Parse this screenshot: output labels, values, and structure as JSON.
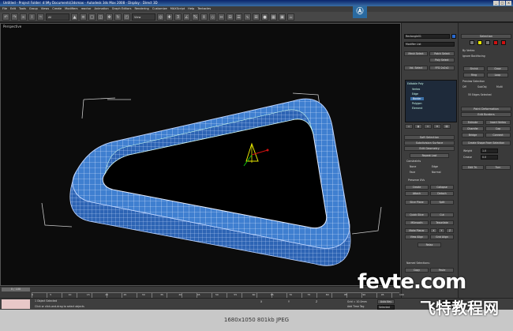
{
  "window": {
    "title": "Untitled  -  Project Folder: d:\\My Documents\\3dsmax  -  Autodesk 3ds Max 2008  -  Display : Direct 3D",
    "controls": [
      "_",
      "□",
      "×"
    ]
  },
  "menu": [
    "File",
    "Edit",
    "Tools",
    "Group",
    "Views",
    "Create",
    "Modifiers",
    "reactor",
    "Animation",
    "Graph Editors",
    "Rendering",
    "Customize",
    "MAXScript",
    "Help",
    "Tentacles"
  ],
  "toolbar": {
    "selection_filter": "All",
    "view_dropdown": "View"
  },
  "logo": "Ⓐ",
  "viewport": {
    "label": "Perspective"
  },
  "command_panel": {
    "object_name": "Rectangle01",
    "modifier_list": "Modifier List",
    "buttons": [
      "Mesh Select",
      "Patch Select",
      "Poly Select",
      "Vol. Select",
      "FFD 2x2x2"
    ],
    "stack": [
      "Editable Poly",
      "Vertex",
      "Edge",
      "Border",
      "Polygon",
      "Element"
    ],
    "rollouts": [
      "Soft Selection",
      "Subdivision Surface",
      "Edit Geometry"
    ],
    "geometry_items": [
      "Repeat Last",
      "Constraints",
      "None",
      "Edge",
      "Face",
      "Normal",
      "Preserve UVs",
      "Create",
      "Collapse",
      "Attach",
      "Detach",
      "Slice Plane",
      "Split",
      "Quick Slice",
      "Cut",
      "MSmooth",
      "Tessellate",
      "Make Planar",
      "X",
      "Y",
      "Z",
      "View Align",
      "Grid Align",
      "Relax",
      "Named Selections:",
      "Copy",
      "Paste"
    ]
  },
  "right_panel": {
    "selection_title": "Selection",
    "by_vertex": "By Vertex",
    "ignore_backfacing": "Ignore Backfacing",
    "shrink": "Shrink",
    "grow": "Grow",
    "ring": "Ring",
    "loop": "Loop",
    "preview_selection": "Preview Selection",
    "off": "Off",
    "subobj": "SubObj",
    "multi": "Multi",
    "edges_selected": "55 Edges Selected",
    "paint_deformation": "Paint Deformation",
    "edit_borders": "Edit Borders",
    "extrude": "Extrude",
    "insert_vertex": "Insert Vertex",
    "chamfer": "Chamfer",
    "cap": "Cap",
    "bridge": "Bridge",
    "connect": "Connect",
    "create_shape": "Create Shape From Selection",
    "weight_label": "Weight",
    "weight_value": "1.0",
    "crease_label": "Crease",
    "crease_value": "0.0",
    "edit_tri": "Edit Tri.",
    "turn": "Turn",
    "colors": [
      "#e8e800",
      "#d01010",
      "#d01010"
    ]
  },
  "timeline": {
    "slider": "0 / 100",
    "ticks": [
      "0",
      "5",
      "10",
      "15",
      "20",
      "25",
      "30",
      "35",
      "40",
      "45",
      "50",
      "55",
      "60",
      "65",
      "70",
      "75",
      "80",
      "85",
      "90",
      "95",
      "100"
    ]
  },
  "status": {
    "selected": "1 Object Selected",
    "prompt": "Click or click-and-drag to select objects",
    "x_label": "X",
    "y_label": "Y",
    "z_label": "Z",
    "grid": "Grid = 10.0mm",
    "auto_key": "Auto Key",
    "selected_dropdown": "Selected",
    "add_time_tag": "Add Time Tag",
    "frame": "0"
  },
  "caption": "1680x1050  801kb  JPEG",
  "watermark": {
    "line1": "fevte.com",
    "line2": "飞特教程网"
  }
}
